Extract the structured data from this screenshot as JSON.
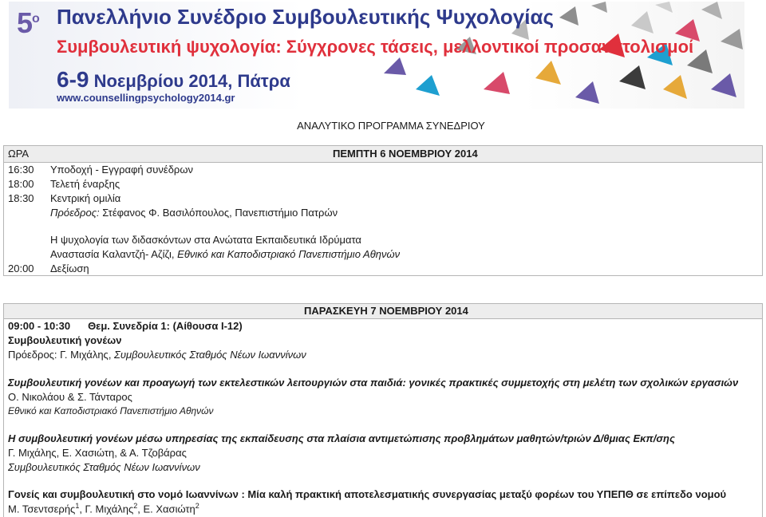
{
  "banner": {
    "edition_number": "5",
    "edition_suffix": "ο",
    "title": "Πανελλήνιο Συνέδριο Συμβουλευτικής Ψυχολογίας",
    "subtitle": "Συμβουλευτική ψυχολογία: Σύγχρονες τάσεις, μελλοντικοί προσανατολισμοί",
    "dates_big": "6-9",
    "dates_rest": "Νοεμβρίου 2014, Πάτρα",
    "url": "www.counsellingpsychology2014.gr",
    "colors": {
      "navy": "#2e3a8c",
      "red": "#e0303c",
      "purple": "#6a5aa8"
    }
  },
  "heading": "ΑΝΑΛΥΤΙΚΟ ΠΡΟΓΡΑΜΜΑ ΣΥΝΕΔΡΙΟΥ",
  "day1": {
    "col_label": "ΩΡΑ",
    "title": "ΠΕΜΠΤΗ 6 ΝΟΕΜΒΡΙΟΥ 2014",
    "rows": [
      {
        "time": "16:30",
        "text": "Υποδοχή - Εγγραφή συνέδρων"
      },
      {
        "time": "18:00",
        "text": "Τελετή έναρξης"
      },
      {
        "time": "18:30",
        "text": "Κεντρική ομιλία"
      }
    ],
    "chair_label": "Πρόεδρος:",
    "chair_name": " Στέφανος Φ. Βασιλόπουλος, Πανεπιστήμιο Πατρών",
    "keynote_title": "Η ψυχολογία των διδασκόντων στα Ανώτατα Εκπαιδευτικά Ιδρύματα",
    "keynote_speaker": "Αναστασία Καλαντζή- Αζίζι,",
    "keynote_affil": " Εθνικό και Καποδιστριακό Πανεπιστήμιο Αθηνών",
    "last_time": "20:00",
    "last_text": "Δεξίωση"
  },
  "day2": {
    "title": "ΠΑΡΑΣΚΕΥΗ 7 ΝΟΕΜΒΡΙΟΥ 2014",
    "session_time": "09:00 - 10:30",
    "session_label": "Θεμ. Συνεδρία 1:  (Αίθουσα Ι-12)",
    "session_title": "Συμβουλευτική γονέων",
    "chair_label": "Πρόεδρος: Γ. Μιχάλης, ",
    "chair_affil": "Συμβουλευτικός Σταθμός Νέων Ιωαννίνων",
    "talks": [
      {
        "title": "Συμβουλευτική γονέων και προαγωγή των εκτελεστικών λειτουργιών στα παιδιά: γονικές πρακτικές συμμετοχής στη μελέτη των σχολικών εργασιών",
        "authors": "Ο. Νικολάου & Σ. Τάνταρος",
        "affil": "Εθνικό και Καποδιστριακό Πανεπιστήμιο Αθηνών"
      },
      {
        "title": "Η συμβουλευτική γονέων μέσω υπηρεσίας της εκπαίδευσης στα πλαίσια αντιμετώπισης προβλημάτων μαθητών/τριών Δ/θμιας Εκπ/σης",
        "authors": "Γ. Μιχάλης, Ε. Χασιώτη, & Α. Τζοβάρας",
        "affil": "Συμβουλευτικός Σταθμός Νέων Ιωαννίνων"
      },
      {
        "title": "Γονείς και συμβουλευτική στο νομό Ιωαννίνων : Μία καλή πρακτική αποτελεσματικής συνεργασίας μεταξύ φορέων του ΥΠΕΠΘ σε επίπεδο νομού",
        "author1": "Μ. Τσεντσερής",
        "sup1": "1",
        "author2": ", Γ. Μιχάλης",
        "sup2": "2",
        "author3": ", Ε. Χασιώτη",
        "sup3": "2"
      }
    ]
  }
}
